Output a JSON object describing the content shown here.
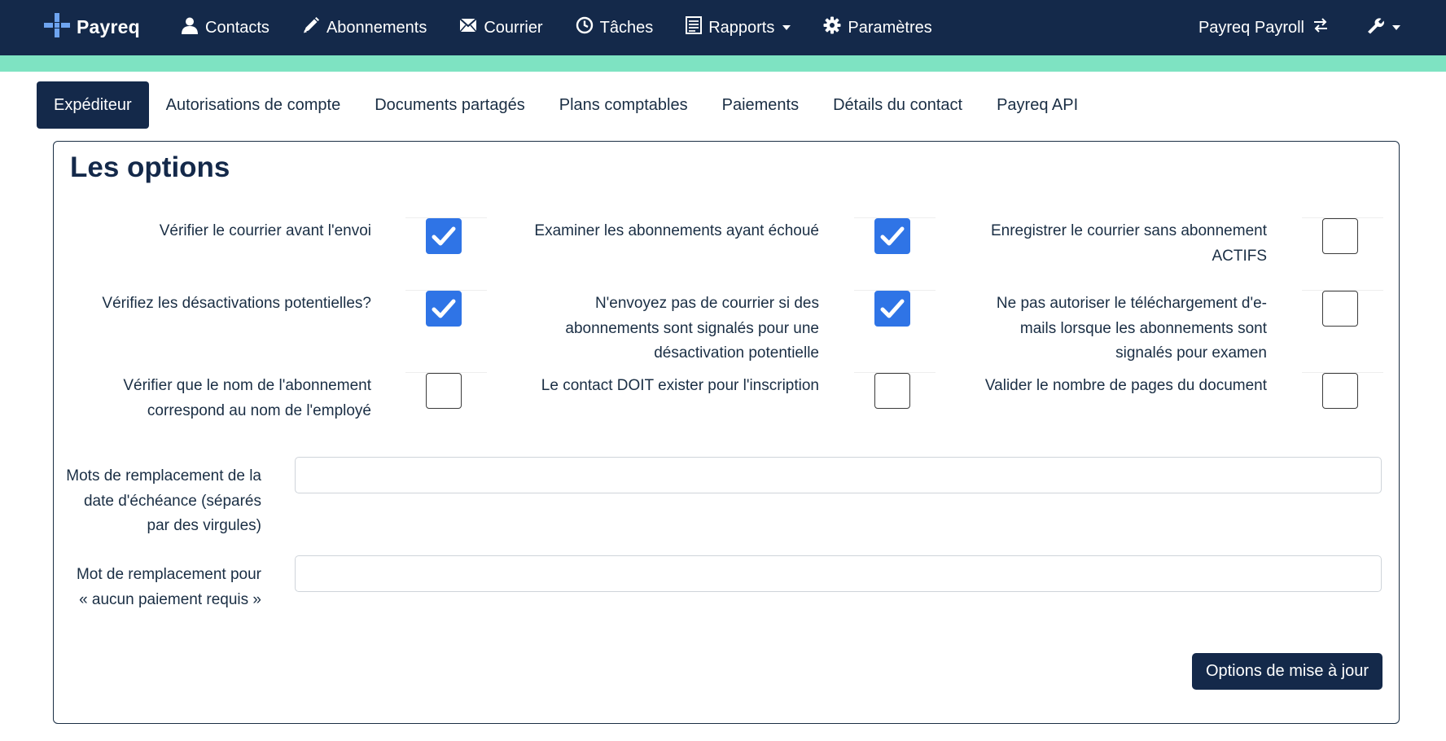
{
  "brand": {
    "name": "Payreq"
  },
  "nav": [
    {
      "label": "Contacts",
      "icon": "user-icon"
    },
    {
      "label": "Abonnements",
      "icon": "pencil-icon"
    },
    {
      "label": "Courrier",
      "icon": "envelope-icon"
    },
    {
      "label": "Tâches",
      "icon": "clock-icon"
    },
    {
      "label": "Rapports",
      "icon": "report-icon",
      "dropdown": true
    },
    {
      "label": "Paramètres",
      "icon": "gear-icon"
    }
  ],
  "account": {
    "label": "Payreq Payroll",
    "icon": "switch-icon"
  },
  "tools": {
    "icon": "wrench-icon"
  },
  "tabs": [
    {
      "label": "Expéditeur",
      "active": true
    },
    {
      "label": "Autorisations de compte"
    },
    {
      "label": "Documents partagés"
    },
    {
      "label": "Plans comptables"
    },
    {
      "label": "Paiements"
    },
    {
      "label": "Détails du contact"
    },
    {
      "label": "Payreq API"
    }
  ],
  "options": {
    "title": "Les options",
    "checkboxes": [
      {
        "label": "Vérifier le courrier avant l'envoi",
        "checked": true
      },
      {
        "label": "Examiner les abonnements ayant échoué",
        "checked": true
      },
      {
        "label": "Enregistrer le courrier sans abonnement ACTIFS",
        "checked": false
      },
      {
        "label": "Vérifiez les désactivations potentielles?",
        "checked": true
      },
      {
        "label": "N'envoyez pas de courrier si des abonnements sont signalés pour une désactivation potentielle",
        "checked": true
      },
      {
        "label": "Ne pas autoriser le téléchargement d'e-mails lorsque les abonnements sont signalés pour examen",
        "checked": false
      },
      {
        "label": "Vérifier que le nom de l'abonnement correspond au nom de l'employé",
        "checked": false
      },
      {
        "label": "Le contact DOIT exister pour l'inscription",
        "checked": false
      },
      {
        "label": "Valider le nombre de pages du document",
        "checked": false
      }
    ],
    "fields": [
      {
        "label": "Mots de remplacement de la date d'échéance (séparés par des virgules)",
        "value": ""
      },
      {
        "label": "Mot de remplacement pour « aucun paiement requis »",
        "value": ""
      }
    ],
    "submit_label": "Options de mise à jour"
  },
  "colors": {
    "navbar": "#14294a",
    "accent": "#7ee3c2",
    "checkbox": "#2f74e6"
  }
}
